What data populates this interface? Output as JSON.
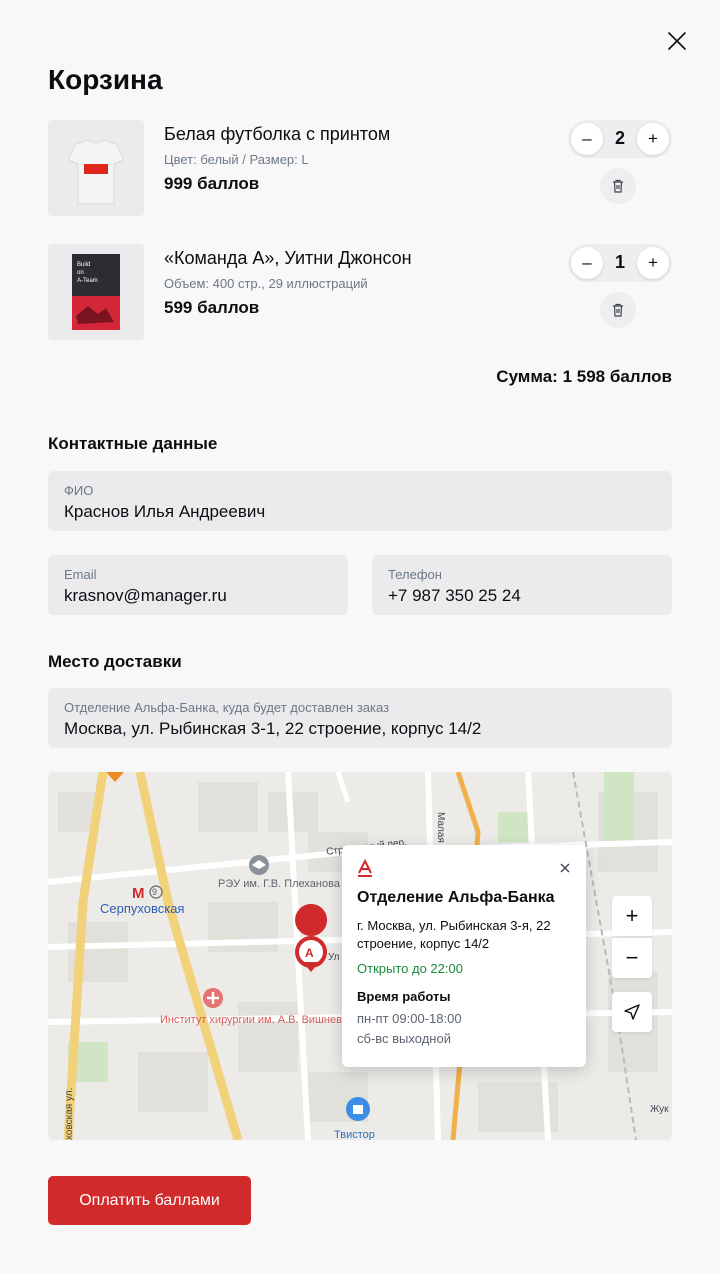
{
  "title": "Корзина",
  "cart": {
    "items": [
      {
        "name": "Белая футболка с принтом",
        "meta": "Цвет: белый   /   Размер: L",
        "price": "999 баллов",
        "qty": "2",
        "thumb_icon": "tshirt-image"
      },
      {
        "name": "«Команда А», Уитни Джонсон",
        "meta": "Объем: 400 стр., 29 иллюстраций",
        "price": "599 баллов",
        "qty": "1",
        "thumb_icon": "book-image",
        "book_cover_text": "Build on A-Team"
      }
    ],
    "stepper": {
      "minus": "–",
      "plus": "+"
    },
    "sum": "Сумма: 1 598 баллов"
  },
  "contacts": {
    "title": "Контактные данные",
    "fio": {
      "label": "ФИО",
      "value": "Краснов Илья Андреевич"
    },
    "email": {
      "label": "Email",
      "value": "krasnov@manager.ru"
    },
    "phone": {
      "label": "Телефон",
      "value": "+7 987 350 25 24"
    }
  },
  "delivery": {
    "title": "Место доставки",
    "field": {
      "label": "Отделение Альфа-Банка, куда будет доставлен заказ",
      "value": "Москва, ул. Рыбинская 3-1, 22 строение, корпус 14/2"
    }
  },
  "map": {
    "labels": {
      "metro": "Серпуховская",
      "metro_line": "9",
      "reu": "РЭУ им. Г.В. Плеханова",
      "institute": "Институт хирургии им. А.В. Вишневского",
      "tvistor": "Твистор",
      "street1": "Стремянный пер.",
      "street2": "Малая Пионерская",
      "street3": "ховская ул.",
      "street4": "Жук",
      "street5": "Ул"
    },
    "popup": {
      "logo": "А",
      "title": "Отделение Альфа-Банка",
      "address": "г. Москва, ул. Рыбинская 3-я, 22 строение, корпус 14/2",
      "open": "Открыто до 22:00",
      "hours_title": "Время работы",
      "weekdays": "пн-пт 09:00-18:00",
      "weekend": "сб-вс выходной"
    },
    "controls": {
      "zoom_in": "+",
      "zoom_out": "−"
    }
  },
  "pay_button": "Оплатить баллами",
  "colors": {
    "accent": "#d02a2a",
    "open": "#1a8a3b",
    "field_bg": "#ebebed"
  }
}
